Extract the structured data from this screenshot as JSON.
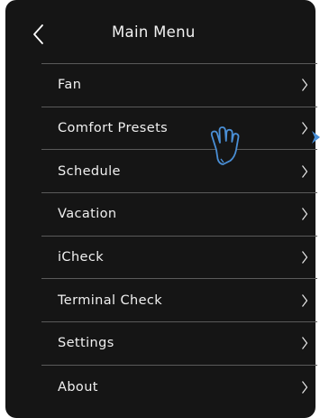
{
  "header": {
    "title": "Main Menu",
    "back_icon": "chevron-left-icon"
  },
  "menu": {
    "items": [
      {
        "label": "Fan",
        "icon": "chevron-right-icon"
      },
      {
        "label": "Comfort Presets",
        "icon": "chevron-right-icon"
      },
      {
        "label": "Schedule",
        "icon": "chevron-right-icon"
      },
      {
        "label": "Vacation",
        "icon": "chevron-right-icon"
      },
      {
        "label": "iCheck",
        "icon": "chevron-right-icon"
      },
      {
        "label": "Terminal Check",
        "icon": "chevron-right-icon"
      },
      {
        "label": "Settings",
        "icon": "chevron-right-icon"
      },
      {
        "label": "About",
        "icon": "chevron-right-icon"
      }
    ]
  },
  "overlay": {
    "pointer_icon": "tap-hand-icon",
    "side_arrow_icon": "arrow-right-icon"
  },
  "colors": {
    "background": "#151515",
    "text": "#f0f0f0",
    "divider": "#5a5a5a",
    "accent": "#4a8fd6"
  }
}
